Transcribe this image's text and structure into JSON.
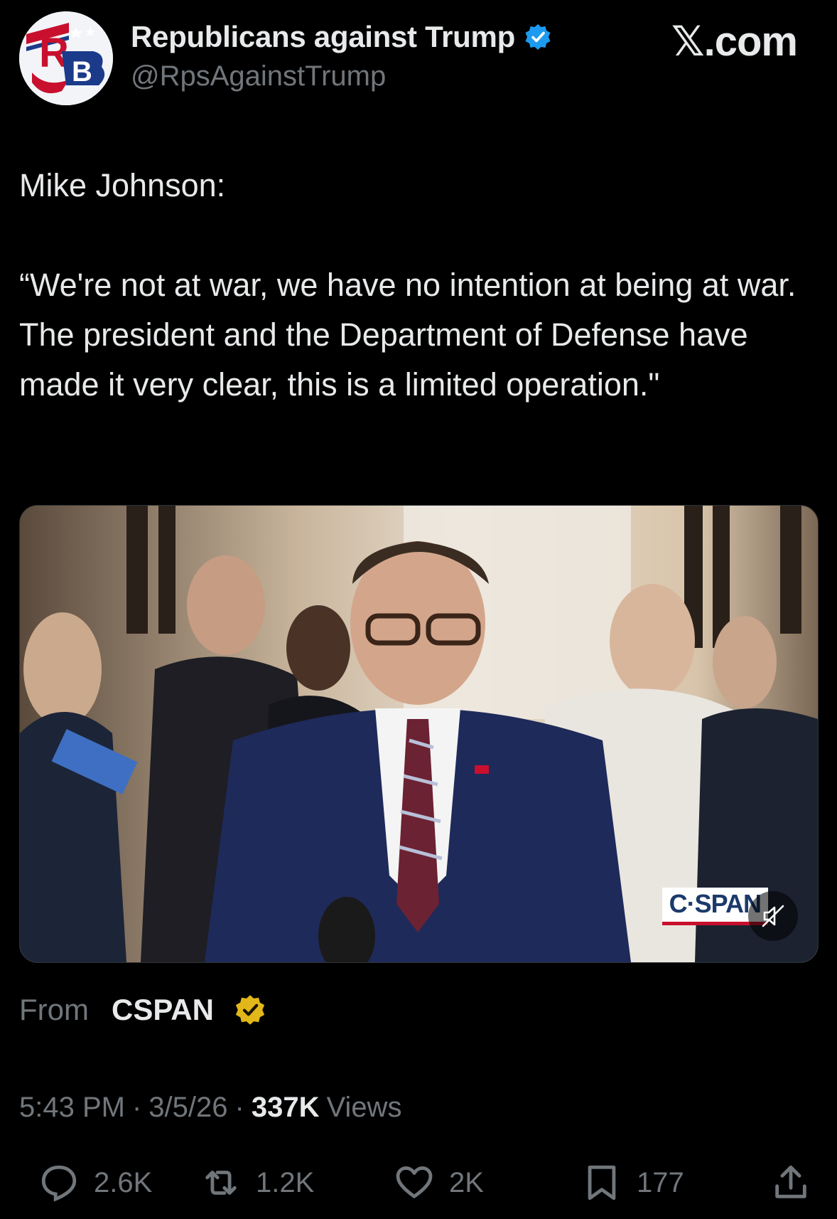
{
  "header": {
    "display_name": "Republicans against Trump",
    "handle": "@RpsAgainstTrump",
    "site": "𝕏.com",
    "avatar_letters": "RB"
  },
  "tweet": {
    "text": "Mike Johnson:\n\n“We're not at war, we have no intention at being at war. The president and the Department of Defense have made it very clear, this is a limited operation.\""
  },
  "media": {
    "watermark": "C·SPAN",
    "icon": "muted-speaker-icon"
  },
  "source": {
    "label": "From",
    "name": "CSPAN"
  },
  "meta": {
    "time": "5:43 PM",
    "date": "3/5/26",
    "views_count": "337K",
    "views_label": "Views",
    "separator": "·"
  },
  "actions": {
    "replies": "2.6K",
    "reposts": "1.2K",
    "likes": "2K",
    "bookmarks": "177"
  },
  "colors": {
    "background": "#000000",
    "text": "#e7e9ea",
    "muted": "#71767b",
    "verified_blue": "#1d9bf0",
    "verified_gold": "#e2b719"
  }
}
